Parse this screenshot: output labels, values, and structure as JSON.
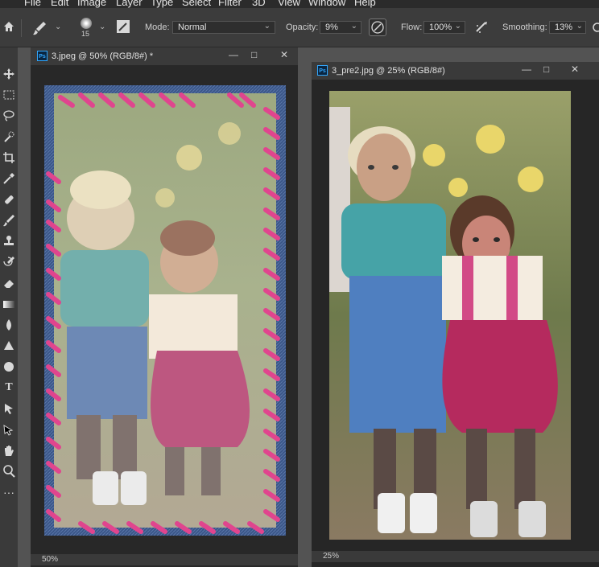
{
  "menu": [
    "File",
    "Edit",
    "Image",
    "Layer",
    "Type",
    "Select",
    "Filter",
    "3D",
    "View",
    "Window",
    "Help"
  ],
  "options": {
    "brush_size": "15",
    "mode_label": "Mode:",
    "mode_value": "Normal",
    "opacity_label": "Opacity:",
    "opacity_value": "9%",
    "flow_label": "Flow:",
    "flow_value": "100%",
    "smoothing_label": "Smoothing:",
    "smoothing_value": "13%"
  },
  "tools": [
    "move-icon",
    "marquee-icon",
    "lasso-icon",
    "quick-select-icon",
    "crop-icon",
    "eyedropper-icon",
    "healing-brush-icon",
    "brush-icon",
    "clone-stamp-icon",
    "history-brush-icon",
    "eraser-icon",
    "gradient-icon",
    "blur-icon",
    "dodge-icon",
    "pen-icon",
    "type-icon",
    "path-select-icon",
    "shape-icon",
    "hand-icon",
    "zoom-icon"
  ],
  "doc1": {
    "title": "3.jpeg @ 50% (RGB/8#) *",
    "zoom": "50%",
    "logo": "Ps"
  },
  "doc2": {
    "title": "3_pre2.jpg @ 25% (RGB/8#)",
    "zoom": "25%",
    "logo": "Ps"
  },
  "window_buttons": {
    "minimize": "—",
    "maximize": "□",
    "close": "✕"
  },
  "colors": {
    "ui_bg": "#535353",
    "panel": "#3a3a3a",
    "doc_bg": "#282828",
    "accent": "#31a8ff",
    "yarn": "#e0458e"
  }
}
